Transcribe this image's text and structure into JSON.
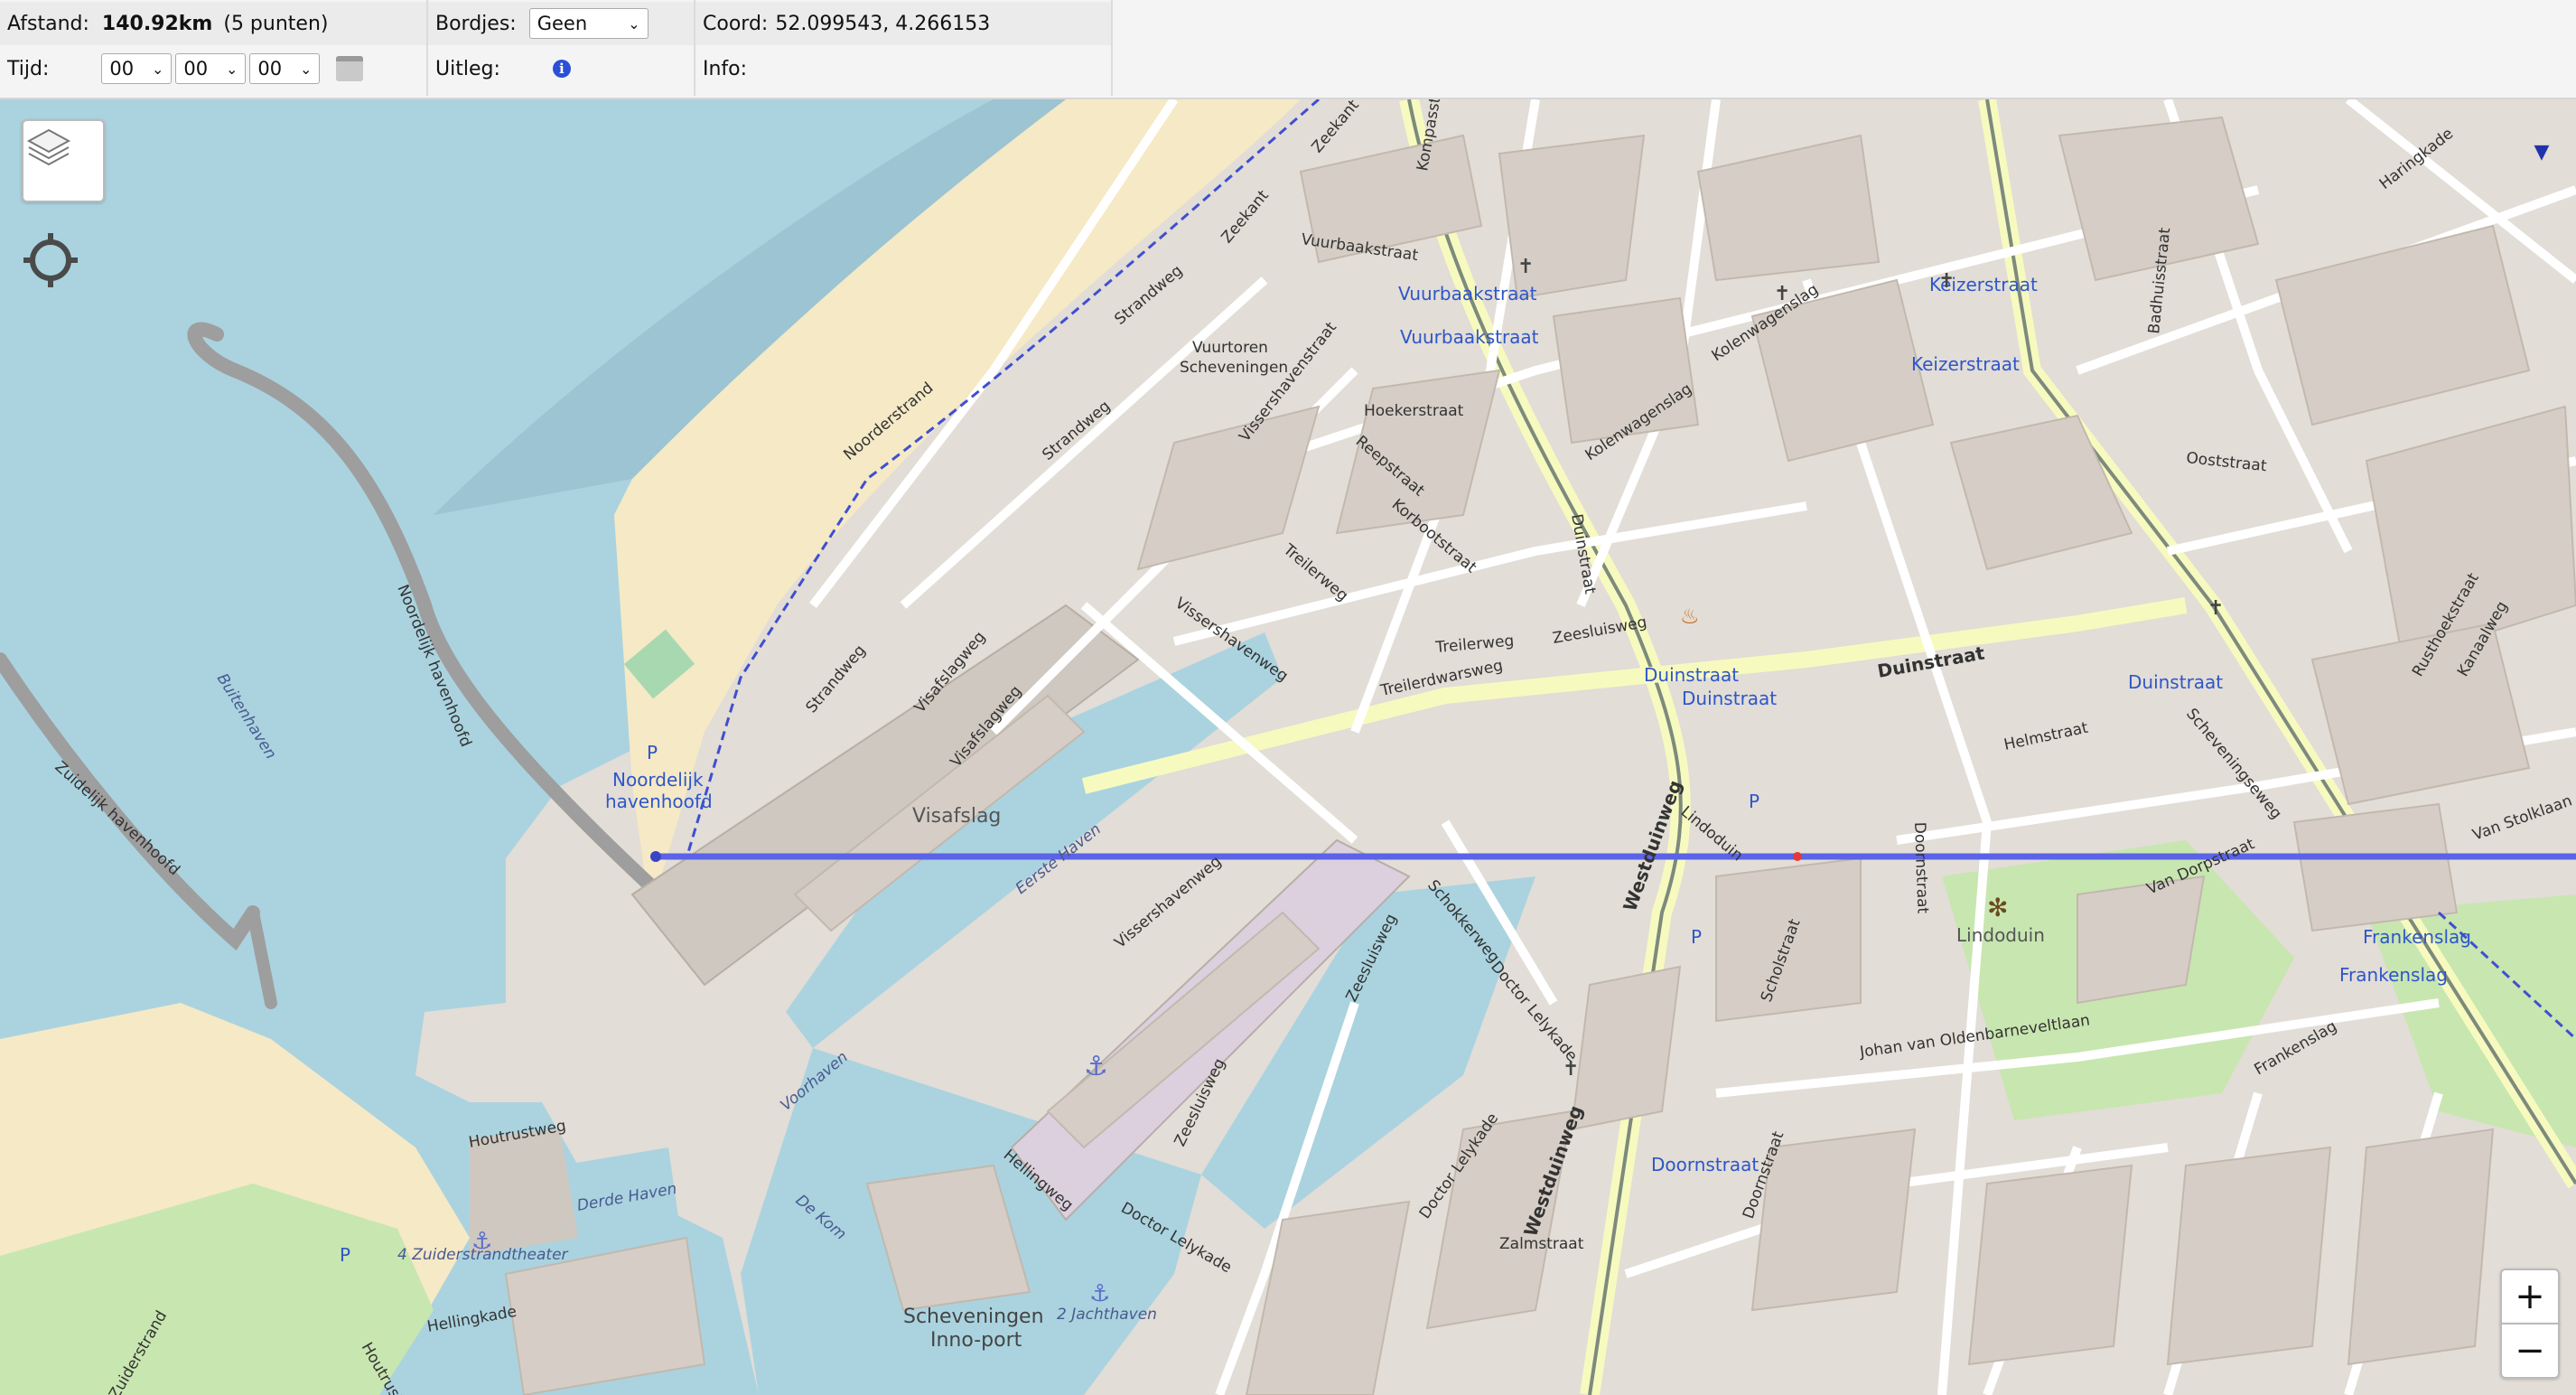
{
  "toolbar": {
    "distance": {
      "label": "Afstand:",
      "value": "140.92km",
      "points": "(5 punten)"
    },
    "time": {
      "label": "Tijd:",
      "hours": "00",
      "minutes": "00",
      "seconds": "00"
    },
    "signs": {
      "label": "Bordjes:",
      "selected": "Geen"
    },
    "legend": {
      "label": "Uitleg:"
    },
    "coord": {
      "label": "Coord:",
      "value": "52.099543, 4.266153"
    },
    "info": {
      "label": "Info:",
      "value": ""
    }
  },
  "map": {
    "route_color": "#5b63e6",
    "water_color": "#aad3df",
    "sand_color": "#f5e9c6",
    "park_color": "#c8e6b0",
    "icons": [
      "layers-icon",
      "locate-icon",
      "zoom-in-icon",
      "zoom-out-icon",
      "minimap-toggle-icon",
      "calendar-icon",
      "info-icon"
    ],
    "controls": {
      "zoom_in": "+",
      "zoom_out": "−",
      "minimap_toggle": "▼"
    },
    "labels": {
      "noorderstrand": "Noorderstrand",
      "strandweg": "Strandweg",
      "zeekant": "Zeekant",
      "vuurbaakstraat": "Vuurbaakstraat",
      "vuurtoren": "Vuurtoren",
      "scheveningen": "Scheveningen",
      "noordelijk_havenhoofd_road": "Noordelijk havenhoofd",
      "noordelijk": "Noordelijk",
      "havenhoofd": "havenhoofd",
      "zuidelijk_havenhoofd": "Zuidelijk havenhoofd",
      "buitenhaven": "Buitenhaven",
      "visafslagweg": "Visafslagweg",
      "visafslag": "Visafslag",
      "eerste_haven": "Eerste Haven",
      "vissershavenweg": "Vissershavenweg",
      "treilerweg": "Treilerweg",
      "treilerdwarsweg": "Treilerdwarsweg",
      "zeesluisweg": "Zeesluisweg",
      "doctor_lelykade": "Doctor Lelykade",
      "westduinweg": "Westduinweg",
      "duinstraat": "Duinstraat",
      "doornstraat": "Doornstraat",
      "lindoduin": "Lindoduin",
      "keizerstraat": "Keizerstraat",
      "kolenwagenslag": "Kolenwagenslag",
      "houtrustweg": "Houtrustweg",
      "derde_haven": "Derde Haven",
      "zuiderstrandtheater": "4 Zuiderstrandtheater",
      "de_kom": "De Kom",
      "voorhaven": "Voorhaven",
      "inno_port_1": "Scheveningen",
      "inno_port_2": "Inno-port",
      "jachthaven": "2 Jachthaven",
      "hellingweg": "Hellingweg",
      "hellingkade": "Hellingkade",
      "zuiderstrand": "Zuiderstrand",
      "frankenslag": "Frankenslag",
      "scheveningseweg": "Scheveningseweg",
      "helmstraat": "Helmstraat",
      "van_dorpstraat": "Van Dorpstraat",
      "johan_van_oldenbarneveltlaan": "Johan van Oldenbarneveltlaan",
      "scholstraat": "Scholstraat",
      "zalmstraat": "Zalmstraat",
      "kanaalweg": "Kanaalweg",
      "rusthoekstraat": "Rusthoekstraat",
      "haringkade": "Haringkade",
      "oosstraat": "Ooststraat",
      "badhuisstraat": "Badhuisstraat",
      "van_stolklaan": "Van Stolklaan",
      "schokkerweg": "Schokkerweg",
      "hoekerstraat": "Hoekerstraat",
      "korbootstraat": "Korbootstraat",
      "reepstraat": "Reepstraat",
      "vissershavenstraat": "Vissershavenstraat",
      "kompasstraat": "Kompasstraat",
      "parking": "P"
    }
  }
}
